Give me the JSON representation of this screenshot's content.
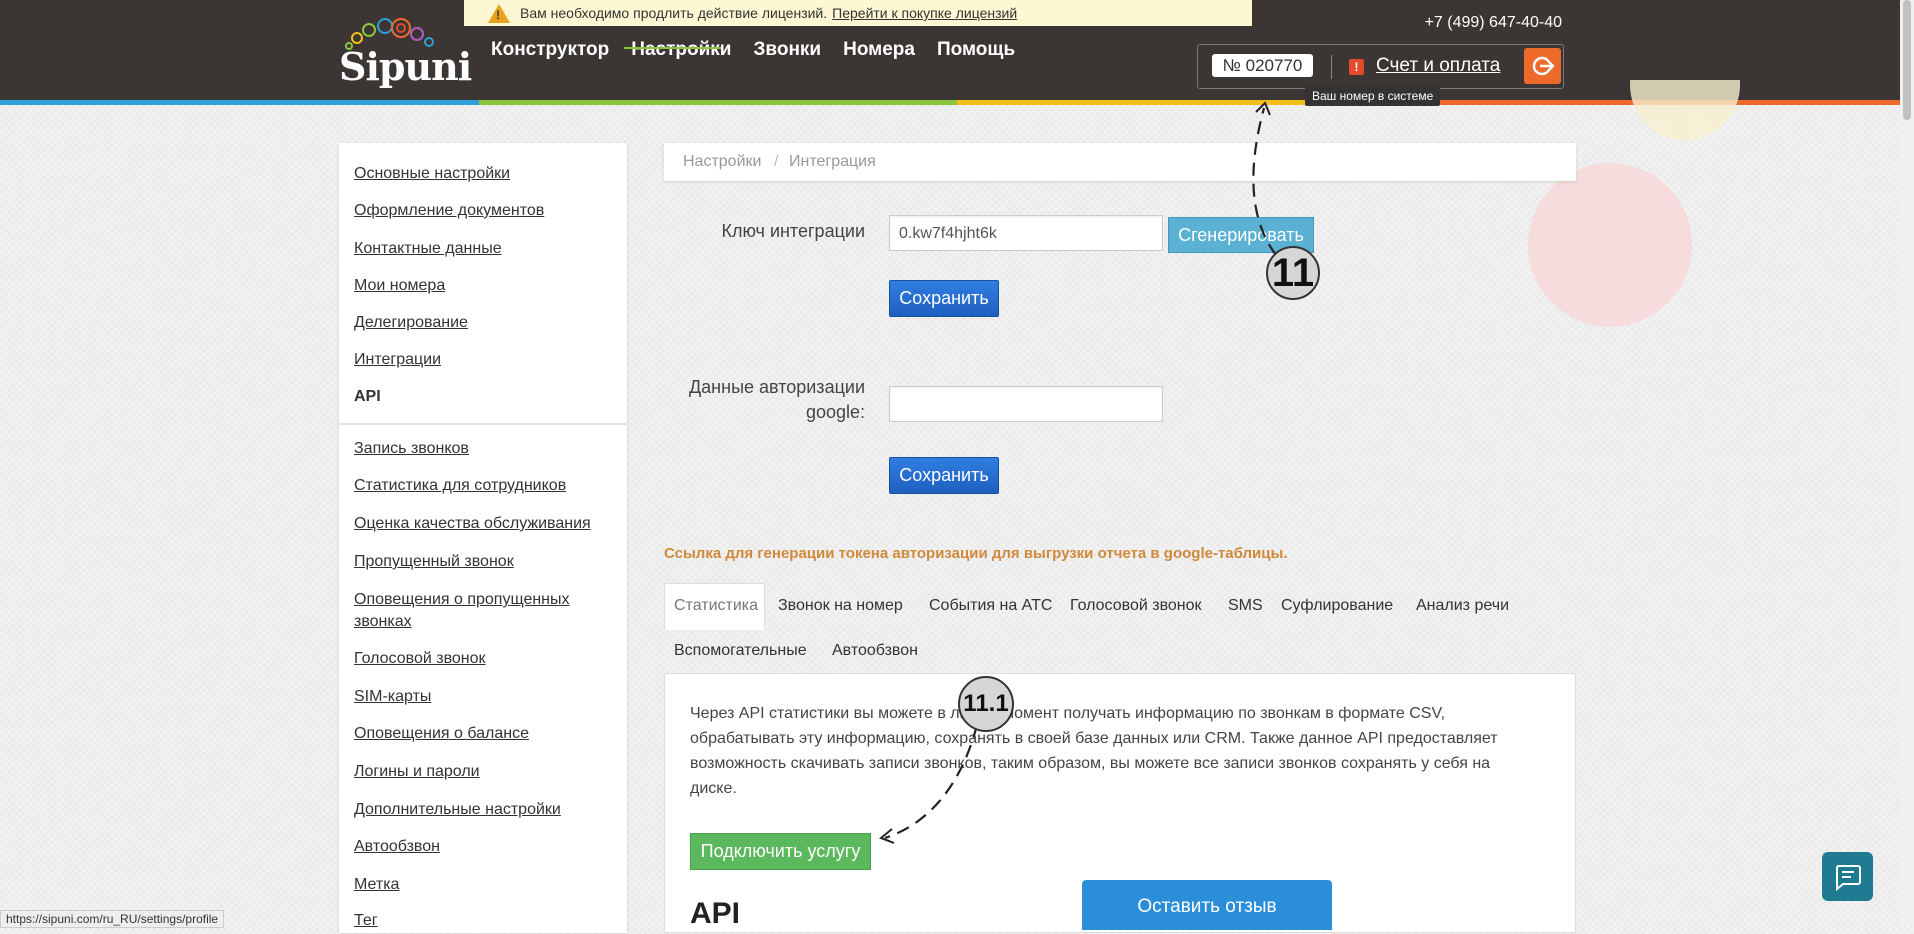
{
  "notice": {
    "text": "Вам необходимо продлить действие лицензий.",
    "link": "Перейти к покупке лицензий"
  },
  "header": {
    "logo": "Sipuni",
    "nav": [
      "Конструктор",
      "Настройки",
      "Звонки",
      "Номера",
      "Помощь"
    ],
    "active_nav": "Настройки",
    "phone": "+7 (499) 647-40-40",
    "account_number": "№ 020770",
    "billing_link": "Счет и оплата",
    "tooltip": "Ваш номер в системе",
    "stripe_colors": [
      "#2e9fd9",
      "#8bc53f",
      "#f2c01c",
      "#ee6a2b"
    ]
  },
  "sidebar": {
    "items_top": [
      "Основные настройки",
      "Оформление документов",
      "Контактные данные",
      "Мои номера",
      "Делегирование",
      "Интеграции"
    ],
    "current": "API",
    "items_bottom": [
      "Запись звонков",
      "Статистика для сотрудников",
      "Оценка качества обслуживания",
      "Пропущенный звонок",
      "Оповещения о пропущенных звонках",
      "Голосовой звонок",
      "SIM-карты",
      "Оповещения о балансе",
      "Логины и пароли",
      "Дополнительные настройки",
      "Автообзвон",
      "Метка",
      "Тег"
    ]
  },
  "breadcrumb": {
    "root": "Настройки",
    "sep": "/",
    "current": "Интеграция"
  },
  "integration": {
    "key_label": "Ключ интеграции",
    "key_value": "0.kw7f4hjht6k",
    "generate_button": "Сгенерировать",
    "save_button": "Сохранить",
    "google_label_1": "Данные авторизации",
    "google_label_2": "google:",
    "google_value": "",
    "save_button_2": "Сохранить",
    "google_link": "Ссылка для генерации токена авторизации для выгрузки отчета в google-таблицы."
  },
  "tabs": {
    "row1": [
      "Статистика",
      "Звонок на номер",
      "События на АТС",
      "Голосовой звонок",
      "SMS",
      "Суфлирование",
      "Анализ речи"
    ],
    "row2": [
      "Вспомогательные",
      "Автообзвон"
    ],
    "active": "Статистика"
  },
  "panel": {
    "line1": "Через API статистики вы можете в любой момент получать информацию по звонкам в формате CSV,",
    "line2": "обрабатывать эту информацию, сохранять в своей базе данных или CRM. Также данное API предоставляет",
    "line3": "возможность скачивать записи звонков, таким образом, вы можете все записи звонков сохранять у себя на",
    "line4": "диске.",
    "connect_button": "Подключить услугу",
    "heading": "API"
  },
  "feedback_button": "Оставить отзыв",
  "status_url": "https://sipuni.com/ru_RU/settings/profile",
  "annotations": [
    "11",
    "11.1"
  ]
}
